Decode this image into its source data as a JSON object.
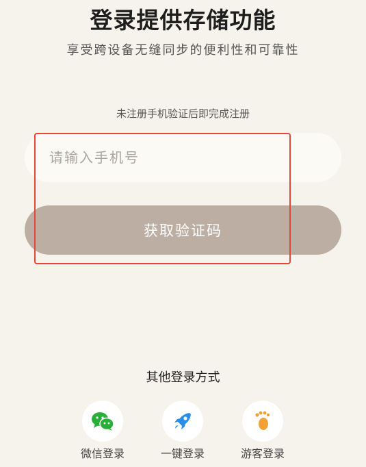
{
  "header": {
    "title": "登录提供存储功能",
    "subtitle": "享受跨设备无缝同步的便利性和可靠性"
  },
  "form": {
    "hint": "未注册手机验证后即完成注册",
    "phone_placeholder": "请输入手机号",
    "phone_value": "",
    "get_code_label": "获取验证码"
  },
  "other_login": {
    "title": "其他登录方式",
    "options": [
      {
        "label": "微信登录",
        "icon": "wechat-icon",
        "color": "#2aae3a"
      },
      {
        "label": "一键登录",
        "icon": "rocket-icon",
        "color": "#2a8ee8"
      },
      {
        "label": "游客登录",
        "icon": "footprint-icon",
        "color": "#f2a134"
      }
    ]
  },
  "colors": {
    "background": "#f6f3ec",
    "button": "#bcaea3",
    "highlight": "#e4473a"
  }
}
